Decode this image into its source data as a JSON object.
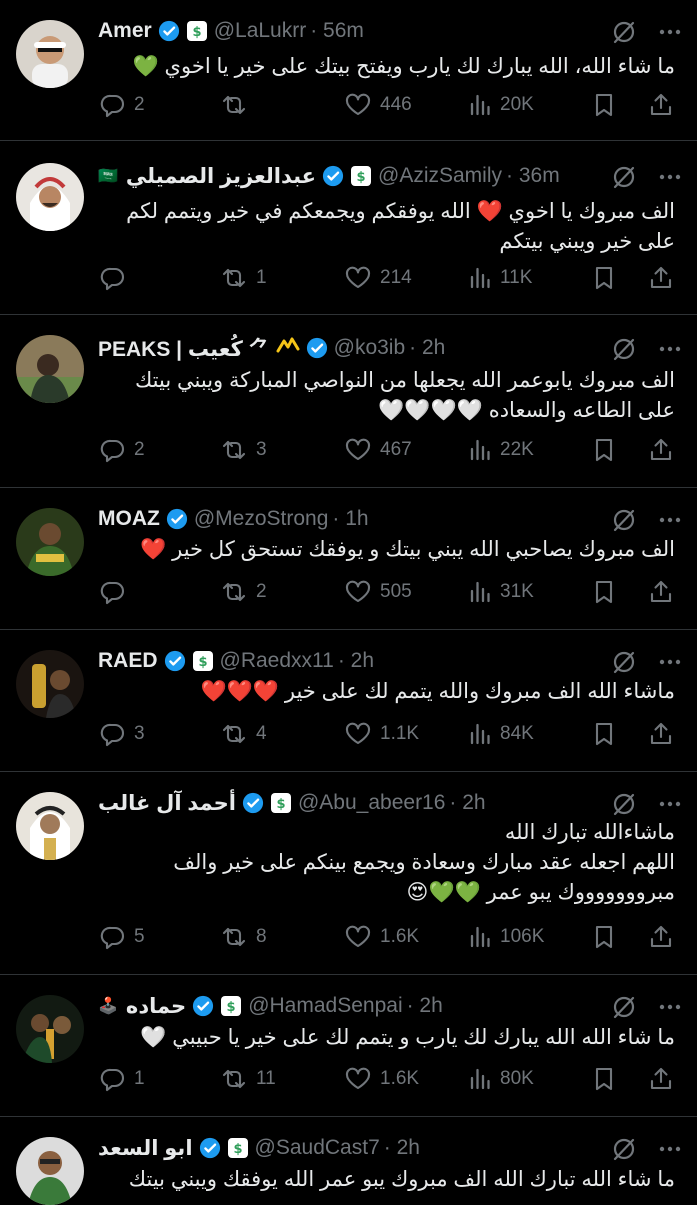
{
  "tweets": [
    {
      "name": "Amer",
      "rtl_name": false,
      "handle": "@LaLukrr",
      "time": "· 56m",
      "extra": "",
      "lines": [
        "ما شاء الله، الله يبارك لك يارب ويفتح بيتك على خير  يا اخوي 💚"
      ],
      "replies": "2",
      "reposts": "",
      "likes": "446",
      "views": "20K"
    },
    {
      "name": "عبدالعزيز الصميلي",
      "rtl_name": true,
      "handle": "@AzizSamily",
      "time": "· 36m",
      "extra": "🇸🇦",
      "lines": [
        "الف مبروك يا اخوي ❤️ الله يوفقكم ويجمعكم في خير ويتمم لكم",
        "على خير ويبني بيتكم"
      ],
      "replies": "",
      "reposts": "1",
      "likes": "214",
      "views": "11K"
    },
    {
      "name": "PEAKS | كُعيب ⺈",
      "rtl_name": false,
      "handle": "@ko3ib",
      "time": "· 2h",
      "extra": "",
      "lines": [
        "الف مبروك يابوعمر الله يجعلها من النواصي المباركة ويبني بيتك",
        "على الطاعه والسعاده 🤍🤍🤍🤍"
      ],
      "replies": "2",
      "reposts": "3",
      "likes": "467",
      "views": "22K"
    },
    {
      "name": "MOAZ",
      "rtl_name": false,
      "handle": "@MezoStrong",
      "time": "· 1h",
      "extra": "",
      "lines": [
        "الف مبروك يصاحبي الله يبني بيتك و يوفقك تستحق كل خير ❤️"
      ],
      "replies": "",
      "reposts": "2",
      "likes": "505",
      "views": "31K"
    },
    {
      "name": "RAED",
      "rtl_name": false,
      "handle": "@Raedxx11",
      "time": "· 2h",
      "extra": "",
      "lines": [
        "ماشاء الله الف مبروك والله يتمم لك على خير ❤️❤️❤️"
      ],
      "replies": "3",
      "reposts": "4",
      "likes": "1.1K",
      "views": "84K"
    },
    {
      "name": "أحمد آل غالب",
      "rtl_name": true,
      "handle": "@Abu_abeer16",
      "time": "· 2h",
      "extra": "",
      "lines": [
        "ماشاءالله تبارك الله",
        "اللهم اجعله عقد مبارك وسعادة ويجمع بينكم على خير والف",
        "مبروووووووك يبو عمر 💚💚😍"
      ],
      "replies": "5",
      "reposts": "8",
      "likes": "1.6K",
      "views": "106K"
    },
    {
      "name": "حماده",
      "rtl_name": true,
      "handle": "@HamadSenpai",
      "time": "· 2h",
      "extra": "🕹️",
      "lines": [
        "ما شاء الله الله يبارك لك يارب و يتمم لك على خير يا حبيبي 🤍"
      ],
      "replies": "1",
      "reposts": "11",
      "likes": "1.6K",
      "views": "80K"
    },
    {
      "name": "ابو السعد",
      "rtl_name": true,
      "handle": "@SaudCast7",
      "time": "· 2h",
      "extra": "",
      "lines": [
        "ما شاء الله تبارك الله الف مبروك يبو عمر الله يوفقك ويبني بيتك"
      ],
      "replies": "",
      "reposts": "",
      "likes": "",
      "views": ""
    }
  ],
  "icons": [
    "verified-badge-icon",
    "affiliate-badge-icon",
    "grok-icon",
    "more-icon",
    "reply-icon",
    "repost-icon",
    "like-icon",
    "views-icon",
    "bookmark-icon",
    "share-icon"
  ],
  "colors": {
    "background": "#000000",
    "text": "#e7e9ea",
    "secondary": "#71767b",
    "verified": "#1d9bf0",
    "divider": "#2f3336"
  }
}
